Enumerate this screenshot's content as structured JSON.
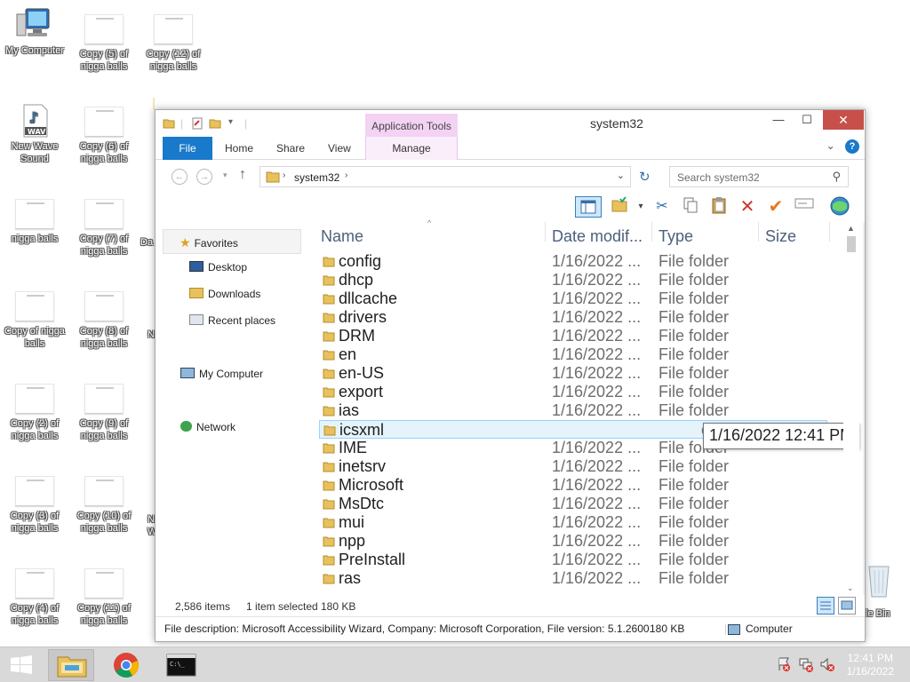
{
  "desktop": {
    "icons": [
      {
        "label": "My Computer",
        "icon": "computer-icon"
      },
      {
        "label": "Copy (5) of nigga balls",
        "icon": "image-file-icon"
      },
      {
        "label": "Copy (12) of nigga balls",
        "icon": "image-file-icon"
      },
      {
        "label": "New Wave Sound",
        "icon": "wav-file-icon"
      },
      {
        "label": "Copy (6) of nigga balls",
        "icon": "image-file-icon"
      },
      {
        "label": "nigga balls",
        "icon": "image-file-icon"
      },
      {
        "label": "Copy (7) of nigga balls",
        "icon": "image-file-icon"
      },
      {
        "label": "Copy of nigga balls",
        "icon": "image-file-icon"
      },
      {
        "label": "Copy (8) of nigga balls",
        "icon": "image-file-icon"
      },
      {
        "label": "Copy (2) of nigga balls",
        "icon": "image-file-icon"
      },
      {
        "label": "Copy (9) of nigga balls",
        "icon": "image-file-icon"
      },
      {
        "label": "Copy (3) of nigga balls",
        "icon": "image-file-icon"
      },
      {
        "label": "Copy (10) of nigga balls",
        "icon": "image-file-icon"
      },
      {
        "label": "Copy (4) of nigga balls",
        "icon": "image-file-icon"
      },
      {
        "label": "Copy (11) of nigga balls",
        "icon": "image-file-icon"
      }
    ],
    "partial_labels": {
      "da": "Da",
      "n1": "N",
      "n2": "N",
      "n2b": "W",
      "n3": "N",
      "n3b": "V",
      "recycle": "le Bin"
    }
  },
  "window": {
    "title": "system32",
    "app_tools": "Application Tools",
    "tabs": {
      "file": "File",
      "home": "Home",
      "share": "Share",
      "view": "View",
      "manage": "Manage"
    },
    "help": "?",
    "address": {
      "path": "system32"
    },
    "search_placeholder": "Search system32",
    "nav": {
      "favorites": "Favorites",
      "desktop": "Desktop",
      "downloads": "Downloads",
      "recent": "Recent places",
      "computer": "My Computer",
      "network": "Network"
    },
    "columns": {
      "name": "Name",
      "date": "Date modif...",
      "type": "Type",
      "size": "Size"
    },
    "files": [
      {
        "name": "config",
        "date": "1/16/2022 ...",
        "type": "File folder"
      },
      {
        "name": "dhcp",
        "date": "1/16/2022 ...",
        "type": "File folder"
      },
      {
        "name": "dllcache",
        "date": "1/16/2022 ...",
        "type": "File folder"
      },
      {
        "name": "drivers",
        "date": "1/16/2022 ...",
        "type": "File folder"
      },
      {
        "name": "DRM",
        "date": "1/16/2022 ...",
        "type": "File folder"
      },
      {
        "name": "en",
        "date": "1/16/2022 ...",
        "type": "File folder"
      },
      {
        "name": "en-US",
        "date": "1/16/2022 ...",
        "type": "File folder"
      },
      {
        "name": "export",
        "date": "1/16/2022 ...",
        "type": "File folder"
      },
      {
        "name": "ias",
        "date": "1/16/2022 ...",
        "type": "File folder"
      },
      {
        "name": "icsxml",
        "date": "",
        "type": "older"
      },
      {
        "name": "IME",
        "date": "1/16/2022 ...",
        "type": "File folder"
      },
      {
        "name": "inetsrv",
        "date": "1/16/2022 ...",
        "type": "File folder"
      },
      {
        "name": "Microsoft",
        "date": "1/16/2022 ...",
        "type": "File folder"
      },
      {
        "name": "MsDtc",
        "date": "1/16/2022 ...",
        "type": "File folder"
      },
      {
        "name": "mui",
        "date": "1/16/2022 ...",
        "type": "File folder"
      },
      {
        "name": "npp",
        "date": "1/16/2022 ...",
        "type": "File folder"
      },
      {
        "name": "PreInstall",
        "date": "1/16/2022 ...",
        "type": "File folder"
      },
      {
        "name": "ras",
        "date": "1/16/2022 ...",
        "type": "File folder"
      }
    ],
    "tooltip": "1/16/2022 12:41 PM",
    "status": {
      "items": "2,586 items",
      "selected": "1 item selected",
      "size": "180 KB"
    },
    "details": {
      "description": "File description: Microsoft Accessibility Wizard, Company: Microsoft Corporation, File version: 5.1.2600.",
      "size": "180 KB",
      "location": "Computer"
    }
  },
  "taskbar": {
    "time": "12:41 PM",
    "date": "1/16/2022"
  },
  "colors": {
    "accent": "#1979ca",
    "close": "#c7504a",
    "app_tools": "#f4d2f4",
    "selection": "#e5f3fb"
  }
}
